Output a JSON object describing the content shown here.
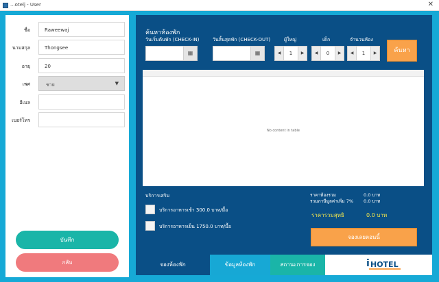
{
  "window": {
    "title": "...otelj - User",
    "close": "✕"
  },
  "customer_form": {
    "fields": [
      {
        "label": "ชื่อ",
        "value": "Raweewaj"
      },
      {
        "label": "นามสกุล",
        "value": "Thongsee"
      },
      {
        "label": "อายุ",
        "value": "20"
      },
      {
        "label": "เพศ",
        "value": "ชาย",
        "type": "select"
      },
      {
        "label": "อีเมล",
        "value": ""
      },
      {
        "label": "เบอร์โทร",
        "value": ""
      }
    ],
    "save_label": "บันทึก",
    "back_label": "กลับ"
  },
  "search": {
    "title": "ค้นหาห้องพัก",
    "checkin_label": "วันเริ่มต้นพัก (CHECK-IN)",
    "checkout_label": "วันสิ้นสุดพัก (CHECK-OUT)",
    "adults_label": "ผู้ใหญ่",
    "children_label": "เด็ก",
    "rooms_label": "จำนวนห้อง",
    "adults_value": "1",
    "children_value": "0",
    "rooms_value": "1",
    "button_label": "ค้นหา",
    "empty_text": "No content in table"
  },
  "services": {
    "title": "บริการเสริม",
    "items": [
      {
        "label": "บริการอาหารเช้า 300.0 บาท/มื้อ"
      },
      {
        "label": "บริการอาหารเย็น 1750.0 บาท/มื้อ"
      }
    ]
  },
  "summary": {
    "room_price_label": "ราคาห้องรวม",
    "room_price_value": "0.0 บาท",
    "vat_label": "รวมภาษีมูลค่าเพิ่ม 7%",
    "vat_value": "0.0 บาท",
    "total_label": "ราคารวมสุทธิ",
    "total_value": "0.0 บาท",
    "checkin_button": "จองเลยตอนนี้"
  },
  "tabs": [
    {
      "label": "จองห้องพัก",
      "color": "#0a4f86"
    },
    {
      "label": "ข้อมูลห้องพัก",
      "color": "#17a8d5"
    },
    {
      "label": "สถานะการจอง",
      "color": "#1ab5a8"
    }
  ],
  "logo": {
    "i": "i",
    "rest": "HOTEL"
  },
  "colors": {
    "background": "#16a9d6",
    "panel": "#0a4f86",
    "accent_orange": "#f9a24a",
    "save_green": "#1ab5a8",
    "back_red": "#f07a7d",
    "total_yellow": "#f6e84b"
  }
}
